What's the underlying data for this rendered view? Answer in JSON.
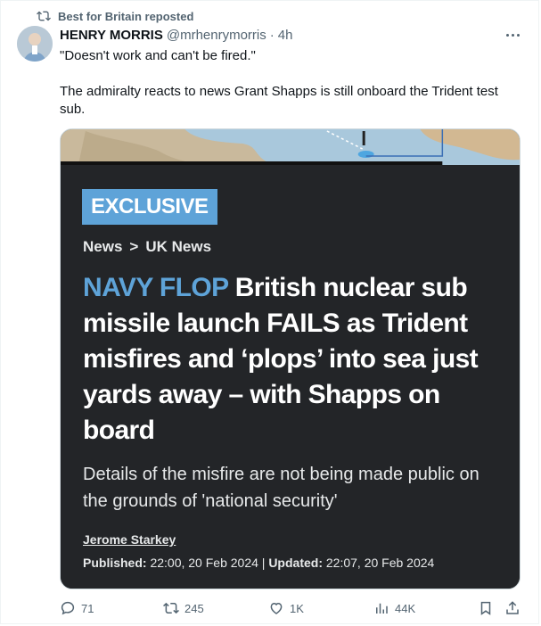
{
  "repost": {
    "text": "Best for Britain reposted",
    "icon": "repost-icon"
  },
  "author": {
    "name": "HENRY MORRIS",
    "handle": "@mrhenrymorris",
    "separator": "·",
    "time": "4h",
    "avatar": "avatar"
  },
  "tweet": {
    "line1": "\"Doesn't work and can't be fired.\"",
    "line2": "The admiralty reacts to news Grant Shapps is still onboard the Trident test sub."
  },
  "article": {
    "badge": "EXCLUSIVE",
    "crumb1": "News",
    "crumb_sep": ">",
    "crumb2": "UK News",
    "kicker": "NAVY FLOP",
    "headline": "British nuclear sub missile launch FAILS as Trident misfires and ‘plops’ into sea just yards away – with Shapps on board",
    "standfirst": "Details of the misfire are not being made public on the grounds of 'national security'",
    "byline": "Jerome Starkey",
    "published_label": "Published:",
    "published_value": "22:00, 20 Feb 2024",
    "divider": "|",
    "updated_label": "Updated:",
    "updated_value": "22:07, 20 Feb 2024"
  },
  "actions": {
    "reply_count": "71",
    "repost_count": "245",
    "like_count": "1K",
    "views_count": "44K"
  },
  "colors": {
    "accent": "#5ea3d8",
    "muted": "#536471",
    "card_bg": "#232528"
  }
}
